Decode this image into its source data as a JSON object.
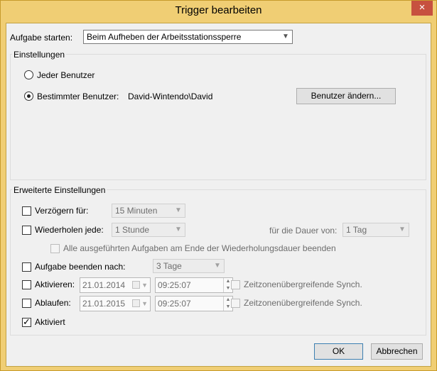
{
  "window": {
    "title": "Trigger bearbeiten",
    "close_glyph": "×"
  },
  "start": {
    "label": "Aufgabe starten:",
    "value": "Beim Aufheben der Arbeitsstationssperre"
  },
  "settings": {
    "group_label": "Einstellungen",
    "radio_any": "Jeder Benutzer",
    "radio_specific": "Bestimmter Benutzer:",
    "user_value": "David-Wintendo\\David",
    "change_user_button": "Benutzer ändern..."
  },
  "advanced": {
    "group_label": "Erweiterte Einstellungen",
    "delay_label": "Verzögern für:",
    "delay_value": "15 Minuten",
    "repeat_label": "Wiederholen jede:",
    "repeat_value": "1 Stunde",
    "duration_label": "für die Dauer von:",
    "duration_value": "1 Tag",
    "stop_all_label": "Alle ausgeführten Aufgaben am Ende der Wiederholungsdauer beenden",
    "stop_after_label": "Aufgabe beenden nach:",
    "stop_after_value": "3 Tage",
    "activate_label": "Aktivieren:",
    "activate_date": "21.01.2014",
    "activate_time": "09:25:07",
    "activate_sync_label": "Zeitzonenübergreifende Synch.",
    "expire_label": "Ablaufen:",
    "expire_date": "21.01.2015",
    "expire_time": "09:25:07",
    "expire_sync_label": "Zeitzonenübergreifende Synch.",
    "enabled_label": "Aktiviert"
  },
  "buttons": {
    "ok": "OK",
    "cancel": "Abbrechen"
  },
  "state": {
    "radio_selected": "specific",
    "delay_checked": false,
    "repeat_checked": false,
    "stop_all_checked": false,
    "stop_after_checked": false,
    "activate_checked": false,
    "expire_checked": false,
    "enabled_checked": true
  },
  "colors": {
    "frame": "#f0ce74",
    "close": "#c7513f",
    "client": "#f0f0f0"
  },
  "icons": {
    "close": "close-icon",
    "dropdown": "chevron-down-icon",
    "calendar": "calendar-icon",
    "check": "checkmark-icon"
  }
}
